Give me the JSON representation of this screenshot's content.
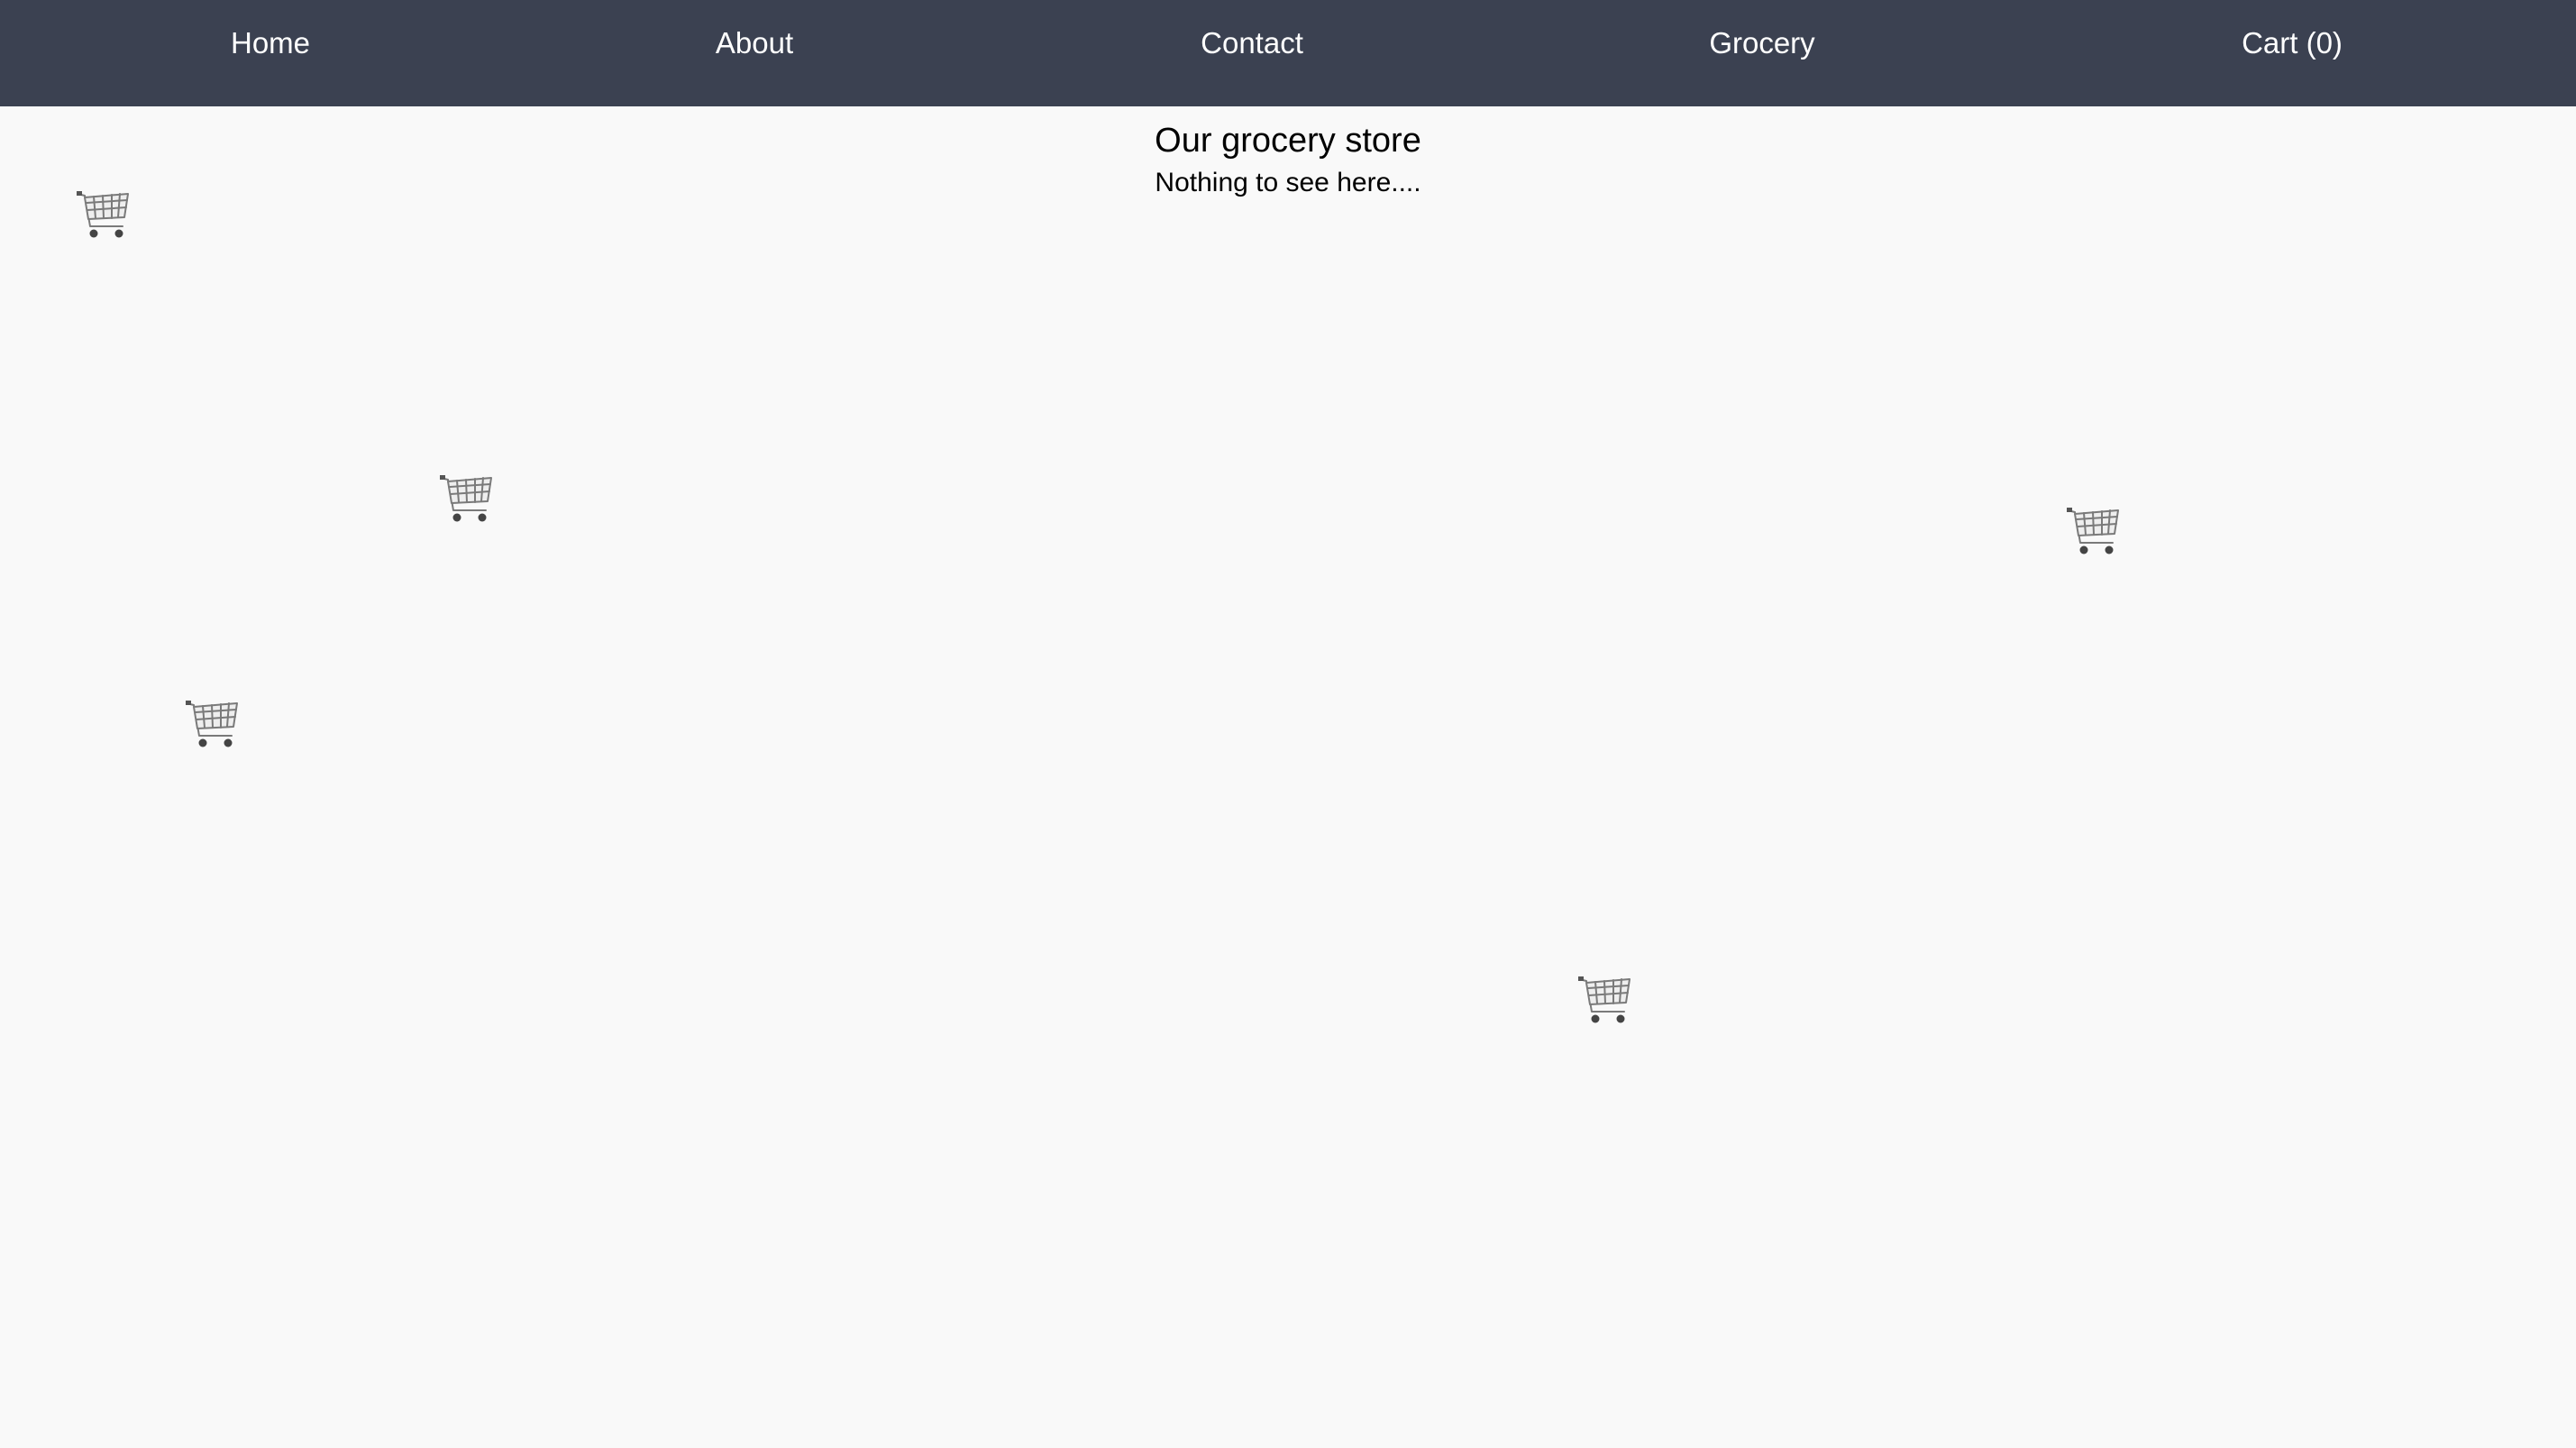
{
  "nav": {
    "home": "Home",
    "about": "About",
    "contact": "Contact",
    "grocery": "Grocery",
    "cart": "Cart (0)"
  },
  "hero": {
    "title": "Our grocery store",
    "subtitle": "Nothing to see here...."
  },
  "decorations": {
    "icon": "shopping-cart-icon",
    "count": 5
  },
  "colors": {
    "navbar": "#3b4151",
    "background": "#f9f9f9",
    "nav_text": "#ffffff"
  }
}
